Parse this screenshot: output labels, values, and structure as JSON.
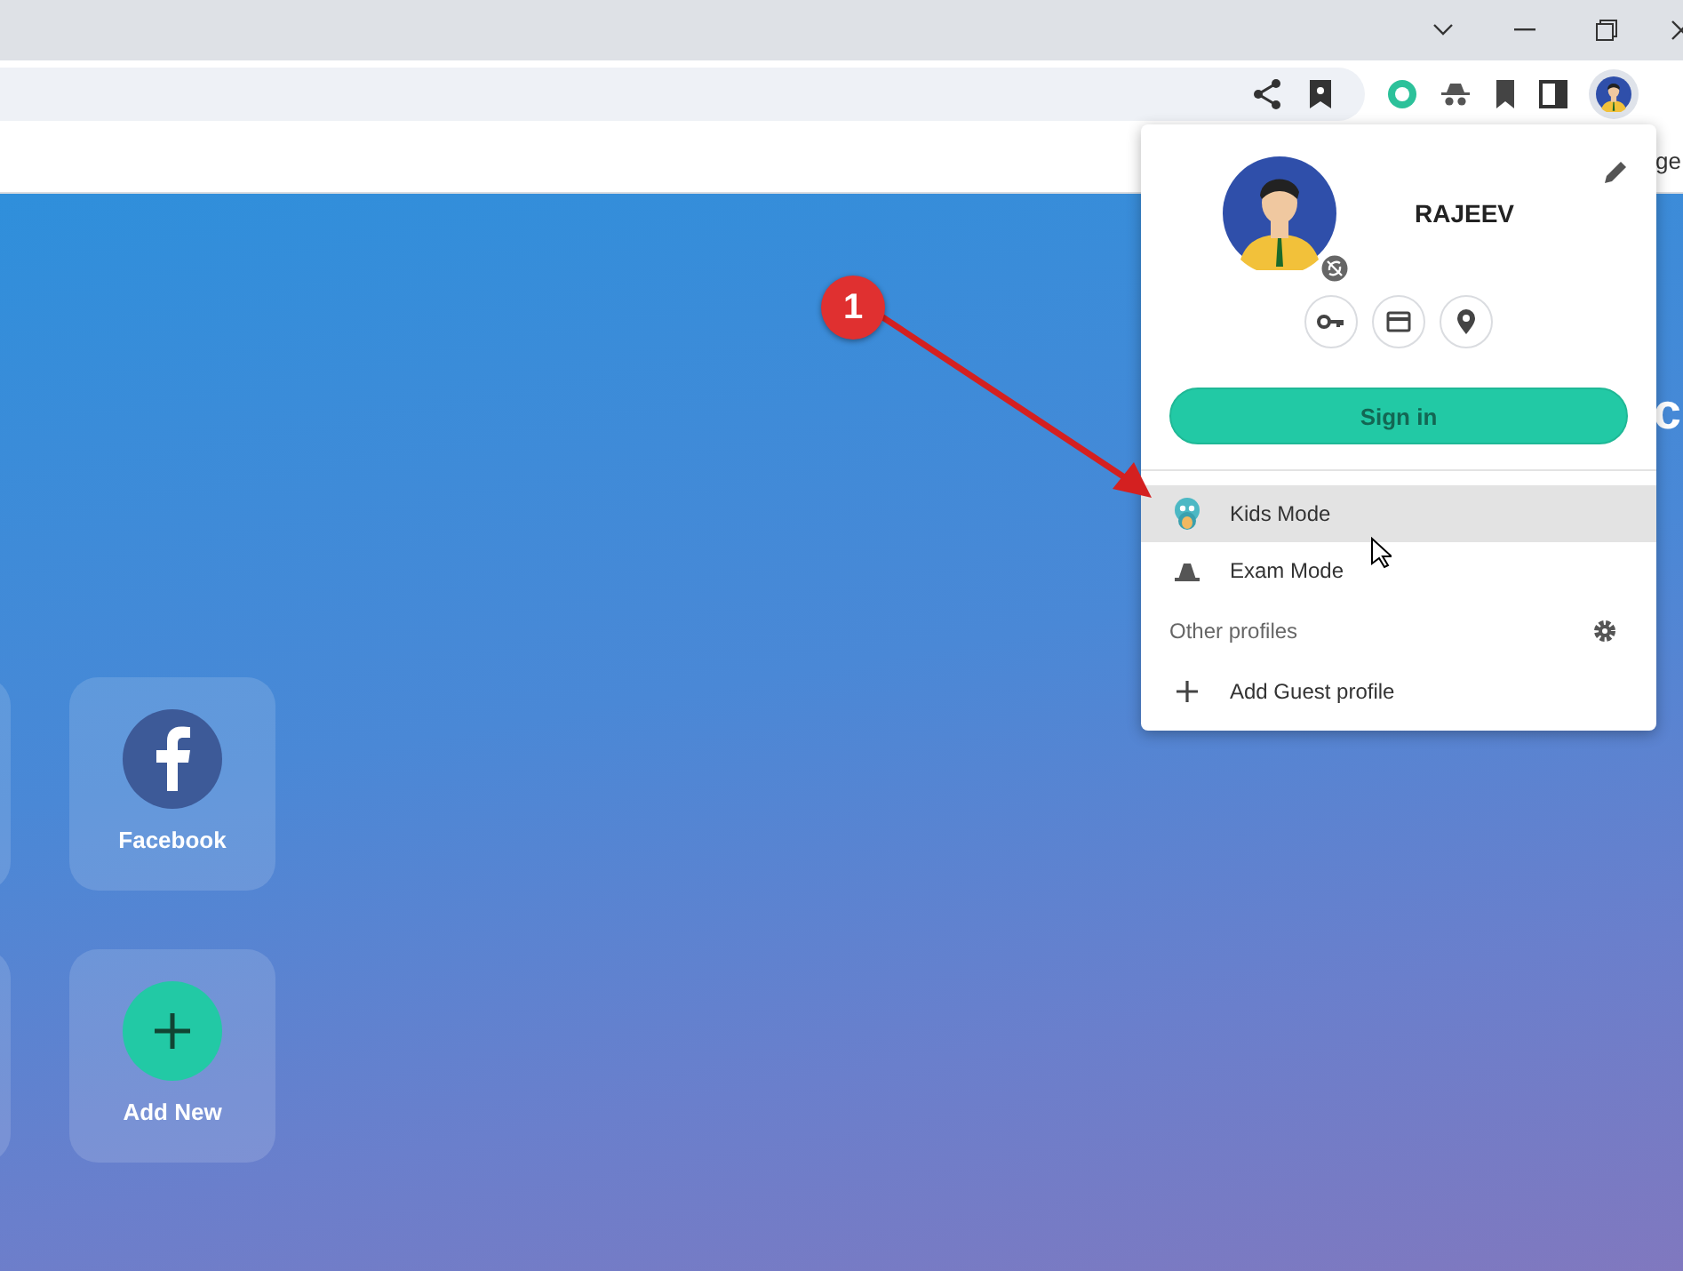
{
  "bookmarks_bar": {
    "edge_text": "ge"
  },
  "page": {
    "heading_fragment": "c",
    "tiles": [
      {
        "label": "Facebook",
        "kind": "facebook"
      },
      {
        "label": "Add New",
        "kind": "add"
      }
    ]
  },
  "profile_menu": {
    "name": "RAJEEV",
    "sign_in": "Sign in",
    "profiles": [
      {
        "label": "Kids Mode",
        "kind": "kids",
        "selected": true
      },
      {
        "label": "Exam Mode",
        "kind": "exam",
        "selected": false
      }
    ],
    "other_profiles": "Other profiles",
    "add_guest": "Add Guest profile"
  },
  "annotation": {
    "number": "1"
  }
}
